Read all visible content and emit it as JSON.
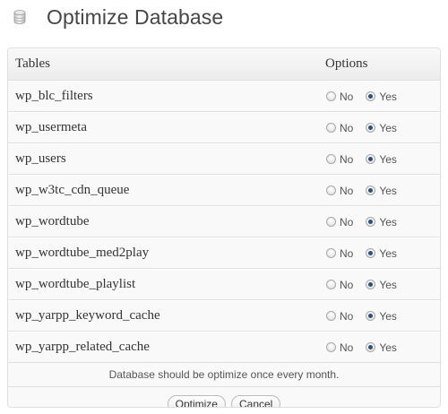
{
  "header": {
    "title": "Optimize Database",
    "icon": "database-icon"
  },
  "table": {
    "columns": [
      "Tables",
      "Options"
    ],
    "no_label": "No",
    "yes_label": "Yes",
    "rows": [
      {
        "name": "wp_blc_filters",
        "selected": "Yes"
      },
      {
        "name": "wp_usermeta",
        "selected": "Yes"
      },
      {
        "name": "wp_users",
        "selected": "Yes"
      },
      {
        "name": "wp_w3tc_cdn_queue",
        "selected": "Yes"
      },
      {
        "name": "wp_wordtube",
        "selected": "Yes"
      },
      {
        "name": "wp_wordtube_med2play",
        "selected": "Yes"
      },
      {
        "name": "wp_wordtube_playlist",
        "selected": "Yes"
      },
      {
        "name": "wp_yarpp_keyword_cache",
        "selected": "Yes"
      },
      {
        "name": "wp_yarpp_related_cache",
        "selected": "Yes"
      }
    ]
  },
  "footer": {
    "note": "Database should be optimize once every month.",
    "optimize_label": "Optimize",
    "cancel_label": "Cancel"
  },
  "colors": {
    "radio_checked": "#2d4f7a",
    "border": "#dfdfdf",
    "background": "#f9f9f9"
  }
}
